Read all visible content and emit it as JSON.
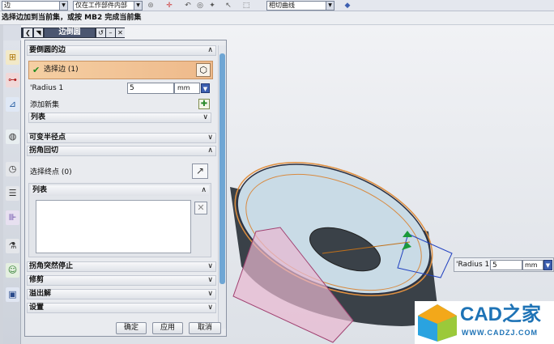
{
  "toolbar": {
    "filter_select": "边",
    "scope_select": "仅在工作部件内部",
    "curve_rule_select": "相切曲线"
  },
  "status_message": "选择边加到当前集，或按 MB2 完成当前集",
  "dialog": {
    "title": "边倒圆",
    "section_edges": "要倒圆的边",
    "select_edge_label": "选择边 (1)",
    "radius_label": "'Radius 1",
    "radius_value": "5",
    "radius_unit": "mm",
    "add_new_set": "添加新集",
    "list_label": "列表",
    "section_variable": "可变半径点",
    "section_corner_setback": "拐角回切",
    "select_endpoint_label": "选择终点 (0)",
    "list_label_2": "列表",
    "section_corner_stop": "拐角突然停止",
    "section_trim": "修剪",
    "section_overflow": "溢出解",
    "section_settings": "设置",
    "ok": "确定",
    "apply": "应用",
    "cancel": "取消"
  },
  "onscreen_input": {
    "label": "'Radius 1",
    "value": "5",
    "unit": "mm"
  },
  "watermark": {
    "brand": "CAD之家",
    "url": "WWW.CADZJ.COM"
  }
}
